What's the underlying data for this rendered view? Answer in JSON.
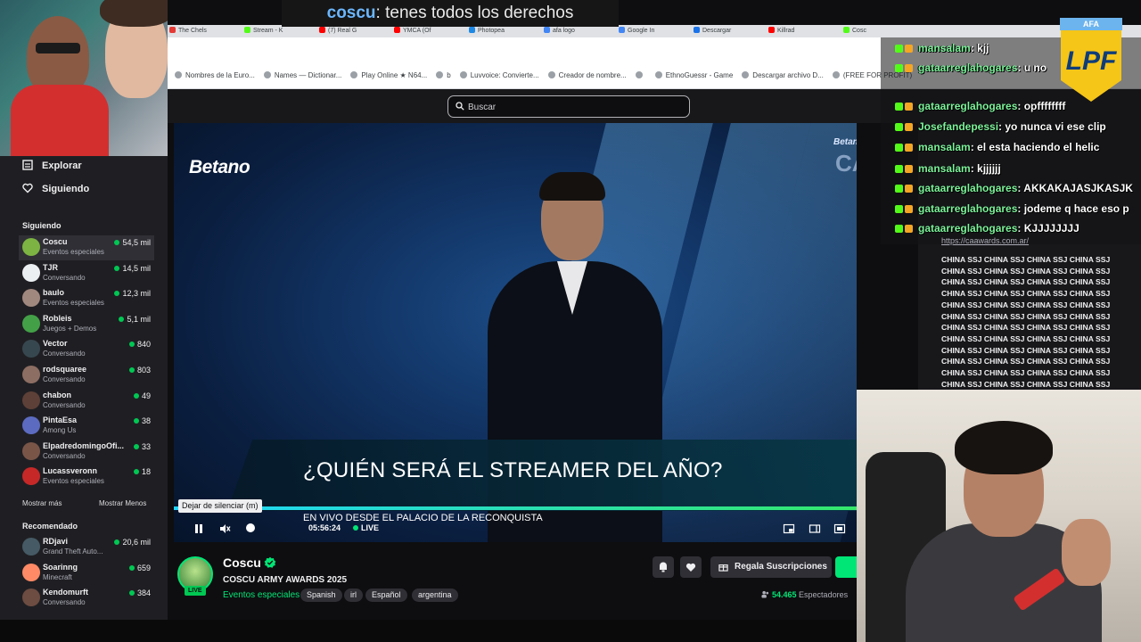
{
  "caption": {
    "user": "coscu",
    "message": ": tenes todos los derechos"
  },
  "browser_tabs": [
    {
      "label": "The Chels",
      "color": "#e53935"
    },
    {
      "label": "Stream - K",
      "color": "#53fc18"
    },
    {
      "label": "(7) Real G",
      "color": "#ff0000"
    },
    {
      "label": "YMCA (Of",
      "color": "#ff0000"
    },
    {
      "label": "Photopea",
      "color": "#1e88e5"
    },
    {
      "label": "afa logo",
      "color": "#4285f4"
    },
    {
      "label": "Google In",
      "color": "#4285f4"
    },
    {
      "label": "Descargar",
      "color": "#1a73e8"
    },
    {
      "label": "Killrad",
      "color": "#ff0000"
    },
    {
      "label": "Cosc",
      "color": "#53fc18"
    }
  ],
  "bookmarks": [
    "Nombres de la Euro...",
    "Names — Dictionar...",
    "Play Online ★ N64...",
    "b",
    "Luvvoice: Convierte...",
    "Creador de nombre...",
    "",
    "EthnoGuessr - Game",
    "Descargar archivo D...",
    "(FREE FOR PROFIT)"
  ],
  "search": {
    "placeholder": "Buscar"
  },
  "sidebar": {
    "nav": [
      {
        "label": "Explorar"
      },
      {
        "label": "Siguiendo"
      }
    ],
    "following_title": "Siguiendo",
    "following": [
      {
        "name": "Coscu",
        "category": "Eventos especiales",
        "viewers": "54,5 mil",
        "avatar": "#7cb342"
      },
      {
        "name": "TJR",
        "category": "Conversando",
        "viewers": "14,5 mil",
        "avatar": "#eceff1"
      },
      {
        "name": "baulo",
        "category": "Eventos especiales",
        "viewers": "12,3 mil",
        "avatar": "#a1887f"
      },
      {
        "name": "Robleis",
        "category": "Juegos + Demos",
        "viewers": "5,1 mil",
        "avatar": "#43a047"
      },
      {
        "name": "Vector",
        "category": "Conversando",
        "viewers": "840",
        "avatar": "#37474f"
      },
      {
        "name": "rodsquaree",
        "category": "Conversando",
        "viewers": "803",
        "avatar": "#8d6e63"
      },
      {
        "name": "chabon",
        "category": "Conversando",
        "viewers": "49",
        "avatar": "#5d4037"
      },
      {
        "name": "PintaEsa",
        "category": "Among Us",
        "viewers": "38",
        "avatar": "#5c6bc0"
      },
      {
        "name": "ElpadredomingoOfi...",
        "category": "Conversando",
        "viewers": "33",
        "avatar": "#795548"
      },
      {
        "name": "Lucassveronn",
        "category": "Eventos especiales",
        "viewers": "18",
        "avatar": "#c62828"
      }
    ],
    "show_more": "Mostrar más",
    "show_less": "Mostrar Menos",
    "recommended_title": "Recomendado",
    "recommended": [
      {
        "name": "RDjavi",
        "category": "Grand Theft Auto...",
        "viewers": "20,6 mil",
        "avatar": "#455a64"
      },
      {
        "name": "Soarinng",
        "category": "Minecraft",
        "viewers": "659",
        "avatar": "#ff8a65"
      },
      {
        "name": "Kendomurft",
        "category": "Conversando",
        "viewers": "384",
        "avatar": "#6d4c41"
      }
    ]
  },
  "video": {
    "sponsor": "Betano",
    "badge": "Betano",
    "badge_logo": "CA",
    "lower_title": "¿QUIÉN SERÁ EL STREAMER DEL AÑO?",
    "lower_sub": "EN VIVO DESDE EL PALACIO DE LA RECONQUISTA",
    "tooltip": "Dejar de silenciar (m)",
    "time": "05:56:24",
    "live": "LIVE"
  },
  "channel": {
    "live_pill": "LIVE",
    "name": "Coscu",
    "title": "COSCU ARMY AWARDS 2025",
    "category": "Eventos especiales",
    "tags": [
      "Spanish",
      "irl",
      "Español",
      "argentina"
    ],
    "subscribe_label": "Regala Suscripciones",
    "viewers": "54.465",
    "viewers_label": "Espectadores"
  },
  "chat": {
    "lines": [
      {
        "user": "mansalam",
        "msg": ": kjj"
      },
      {
        "user": "gataarreglahogares",
        "msg": ": u no"
      },
      {
        "user": "gataarreglahogares",
        "msg": ": opffffffff"
      },
      {
        "user": "Josefandepessi",
        "msg": ": yo nunca vi ese clip"
      },
      {
        "user": "mansalam",
        "msg": ": el     esta haciendo el helic"
      },
      {
        "user": "mansalam",
        "msg": ": kjjjjjj"
      },
      {
        "user": "gataarreglahogares",
        "msg": ": AKKAKAJASJKASJK"
      },
      {
        "user": "gataarreglahogares",
        "msg": ": jodeme q hace eso p"
      },
      {
        "user": "gataarreglahogares",
        "msg": ": KJJJJJJJJ"
      }
    ],
    "link": "https://caawards.com.ar/",
    "spam": "CHINA SSJ CHINA SSJ CHINA SSJ CHINA SSJ CHINA SSJ CHINA SSJ CHINA SSJ CHINA SSJ CHINA SSJ CHINA SSJ CHINA SSJ CHINA SSJ CHINA SSJ CHINA SSJ CHINA SSJ CHINA SSJ CHINA SSJ CHINA SSJ CHINA SSJ CHINA SSJ CHINA SSJ CHINA SSJ CHINA SSJ CHINA SSJ CHINA SSJ CHINA SSJ CHINA SSJ CHINA SSJ CHINA SSJ CHINA SSJ CHINA SSJ CHINA SSJ CHINA SSJ CHINA SSJ CHINA SSJ CHINA SSJ CHINA SSJ CHINA SSJ CHINA SSJ CHINA SSJ CHINA SSJ CHINA SSJ CHINA SSJ CHINA SSJ CHINA SSJ CHINA SSJ CHINA SSJ CHINA SSJ CHINA SSJ CHINA SSJ CHINA SSJ",
    "afa": "AFA",
    "lpf": "LPF"
  },
  "icons": {
    "accent": "#00e676",
    "link_color": "#6bb6ff"
  }
}
